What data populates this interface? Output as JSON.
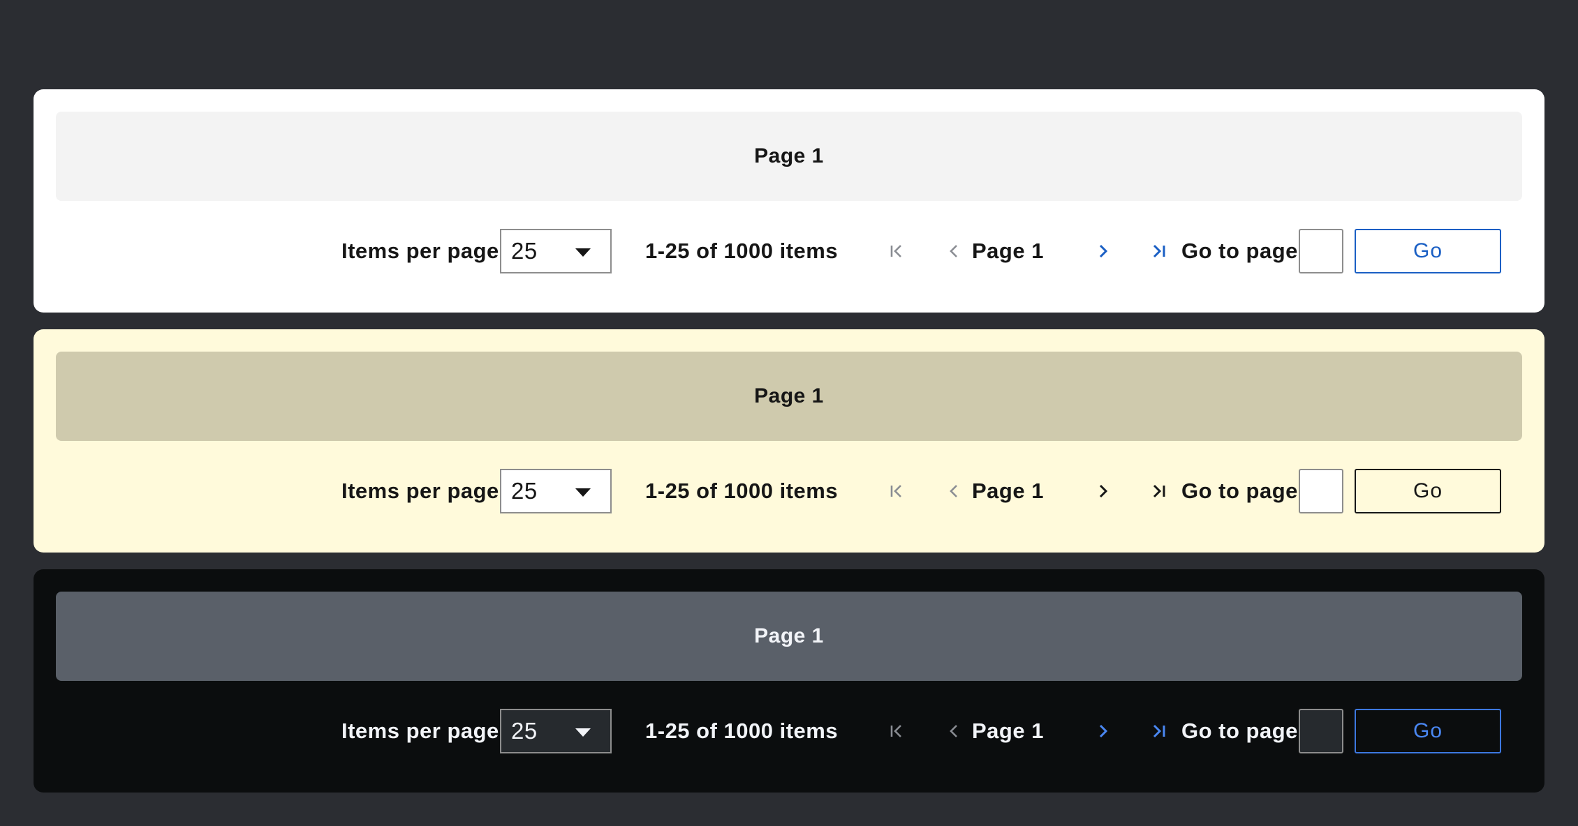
{
  "panels": [
    {
      "theme": "white",
      "banner": "Page 1",
      "items_per_page_label": "Items per page",
      "items_per_page_value": "25",
      "range_text": "1-25 of 1000 items",
      "page_label": "Page 1",
      "goto_label": "Go to page",
      "goto_value": "",
      "go_label": "Go",
      "icons": {
        "first": "first-page-icon",
        "prev": "chevron-left-icon",
        "next": "chevron-right-icon",
        "last": "last-page-icon"
      },
      "accent": "#1a5fc4"
    },
    {
      "theme": "yellow",
      "banner": "Page 1",
      "items_per_page_label": "Items per page",
      "items_per_page_value": "25",
      "range_text": "1-25 of 1000 items",
      "page_label": "Page 1",
      "goto_label": "Go to page",
      "goto_value": "",
      "go_label": "Go",
      "icons": {
        "first": "first-page-icon",
        "prev": "chevron-left-icon",
        "next": "chevron-right-icon",
        "last": "last-page-icon"
      },
      "accent": "#161616"
    },
    {
      "theme": "dark",
      "banner": "Page 1",
      "items_per_page_label": "Items per page",
      "items_per_page_value": "25",
      "range_text": "1-25 of 1000 items",
      "page_label": "Page 1",
      "goto_label": "Go to page",
      "goto_value": "",
      "go_label": "Go",
      "icons": {
        "first": "first-page-icon",
        "prev": "chevron-left-icon",
        "next": "chevron-right-icon",
        "last": "last-page-icon"
      },
      "accent": "#4a87f2"
    }
  ],
  "colors": {
    "page_background": "#2b2d32",
    "disabled_icon": "#8a8d93"
  }
}
